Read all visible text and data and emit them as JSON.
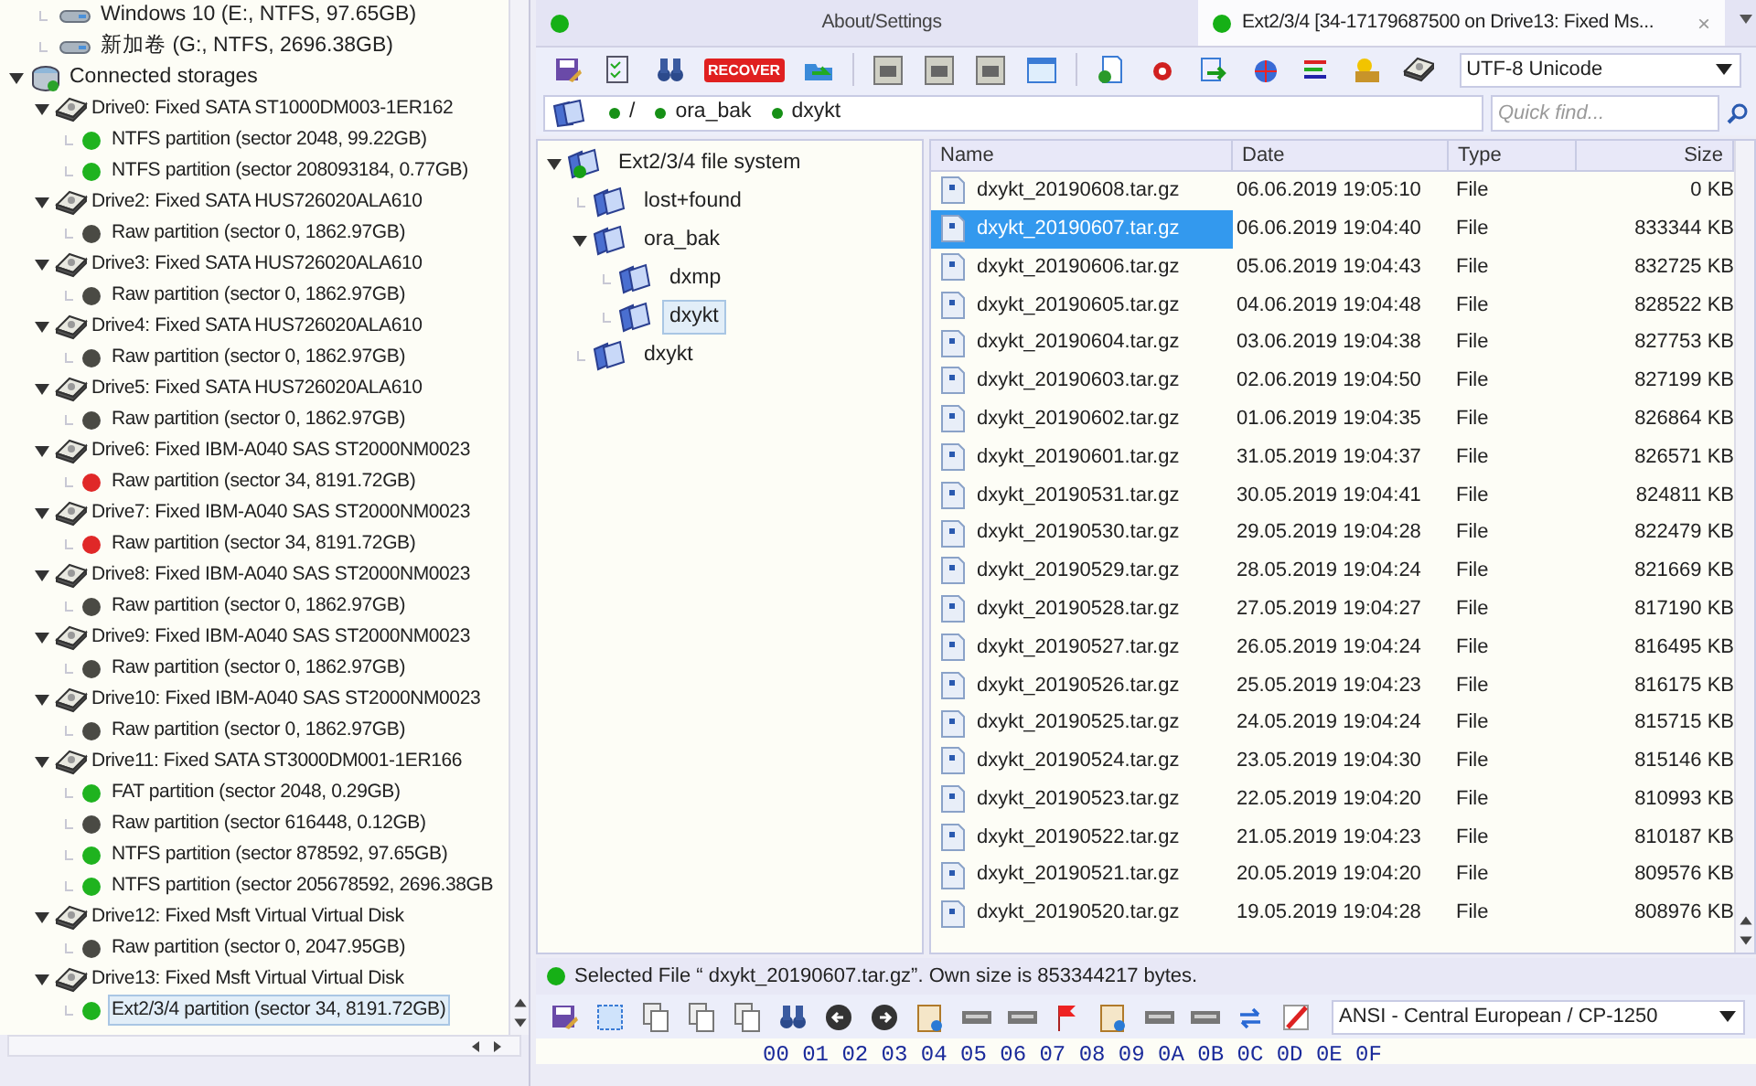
{
  "storage_tree": {
    "local_volumes": [
      {
        "label": "Windows 10 (E:, NTFS, 97.65GB)"
      },
      {
        "label": "新加卷 (G:, NTFS, 2696.38GB)"
      }
    ],
    "connected_storages": {
      "label": "Connected storages",
      "expanded": true,
      "drives": [
        {
          "label": "Drive0: Fixed SATA ST1000DM003-1ER162",
          "expanded": true,
          "partitions": [
            {
              "label": "NTFS partition (sector 2048, 99.22GB)",
              "color": "#1fb31f",
              "selected": false
            },
            {
              "label": "NTFS partition (sector 208093184, 0.77GB)",
              "color": "#1fb31f",
              "selected": false
            }
          ]
        },
        {
          "label": "Drive2: Fixed SATA HUS726020ALA610",
          "expanded": true,
          "partitions": [
            {
              "label": "Raw partition (sector 0, 1862.97GB)",
              "color": "#4a4a44",
              "selected": false
            }
          ]
        },
        {
          "label": "Drive3: Fixed SATA HUS726020ALA610",
          "expanded": true,
          "partitions": [
            {
              "label": "Raw partition (sector 0, 1862.97GB)",
              "color": "#4a4a44",
              "selected": false
            }
          ]
        },
        {
          "label": "Drive4: Fixed SATA HUS726020ALA610",
          "expanded": true,
          "partitions": [
            {
              "label": "Raw partition (sector 0, 1862.97GB)",
              "color": "#4a4a44",
              "selected": false
            }
          ]
        },
        {
          "label": "Drive5: Fixed SATA HUS726020ALA610",
          "expanded": true,
          "partitions": [
            {
              "label": "Raw partition (sector 0, 1862.97GB)",
              "color": "#4a4a44",
              "selected": false
            }
          ]
        },
        {
          "label": "Drive6: Fixed IBM-A040 SAS ST2000NM0023",
          "expanded": true,
          "partitions": [
            {
              "label": "Raw partition (sector 34, 8191.72GB)",
              "color": "#e02828",
              "selected": false
            }
          ]
        },
        {
          "label": "Drive7: Fixed IBM-A040 SAS ST2000NM0023",
          "expanded": true,
          "partitions": [
            {
              "label": "Raw partition (sector 34, 8191.72GB)",
              "color": "#e02828",
              "selected": false
            }
          ]
        },
        {
          "label": "Drive8: Fixed IBM-A040 SAS ST2000NM0023",
          "expanded": true,
          "partitions": [
            {
              "label": "Raw partition (sector 0, 1862.97GB)",
              "color": "#4a4a44",
              "selected": false
            }
          ]
        },
        {
          "label": "Drive9: Fixed IBM-A040 SAS ST2000NM0023",
          "expanded": true,
          "partitions": [
            {
              "label": "Raw partition (sector 0, 1862.97GB)",
              "color": "#4a4a44",
              "selected": false
            }
          ]
        },
        {
          "label": "Drive10: Fixed IBM-A040 SAS ST2000NM0023",
          "expanded": true,
          "partitions": [
            {
              "label": "Raw partition (sector 0, 1862.97GB)",
              "color": "#4a4a44",
              "selected": false
            }
          ]
        },
        {
          "label": "Drive11: Fixed SATA ST3000DM001-1ER166",
          "expanded": true,
          "partitions": [
            {
              "label": "FAT partition (sector 2048, 0.29GB)",
              "color": "#1fb31f",
              "selected": false
            },
            {
              "label": "Raw partition (sector 616448, 0.12GB)",
              "color": "#4a4a44",
              "selected": false
            },
            {
              "label": "NTFS partition (sector 878592, 97.65GB)",
              "color": "#1fb31f",
              "selected": false
            },
            {
              "label": "NTFS partition (sector 205678592, 2696.38GB",
              "color": "#1fb31f",
              "selected": false
            }
          ]
        },
        {
          "label": "Drive12: Fixed Msft Virtual Virtual Disk",
          "expanded": true,
          "partitions": [
            {
              "label": "Raw partition (sector 0, 2047.95GB)",
              "color": "#4a4a44",
              "selected": false
            }
          ]
        },
        {
          "label": "Drive13: Fixed Msft Virtual Virtual Disk",
          "expanded": true,
          "partitions": [
            {
              "label": "Ext2/3/4 partition (sector 34, 8191.72GB)",
              "color": "#1fb31f",
              "selected": true
            }
          ]
        }
      ]
    }
  },
  "tabs": [
    {
      "label": "About/Settings",
      "selected": false
    },
    {
      "label": "Ext2/3/4 [34-17179687500 on Drive13: Fixed Ms...",
      "selected": true,
      "close": "×"
    }
  ],
  "toolbar": {
    "recover_button": "RECOVER",
    "encoding": "UTF-8 Unicode"
  },
  "path_bar": {
    "segments": [
      "/",
      "ora_bak",
      "dxykt"
    ],
    "quick_find_placeholder": "Quick find..."
  },
  "folder_tree": {
    "label": "Ext2/3/4 file system",
    "expanded": true,
    "children": [
      {
        "label": "lost+found",
        "expanded": false,
        "selected": false
      },
      {
        "label": "ora_bak",
        "expanded": true,
        "selected": false,
        "children": [
          {
            "label": "dxmp",
            "expanded": false,
            "selected": false
          },
          {
            "label": "dxykt",
            "expanded": false,
            "selected": true
          }
        ]
      },
      {
        "label": "dxykt",
        "expanded": false,
        "selected": false
      }
    ]
  },
  "file_table": {
    "columns": [
      "Name",
      "Date",
      "Type",
      "Size"
    ],
    "rows": [
      {
        "name": "dxykt_20190608.tar.gz",
        "date": "06.06.2019 19:05:10",
        "type": "File",
        "size": "0 KB",
        "selected": false
      },
      {
        "name": "dxykt_20190607.tar.gz",
        "date": "06.06.2019 19:04:40",
        "type": "File",
        "size": "833344 KB",
        "selected": true
      },
      {
        "name": "dxykt_20190606.tar.gz",
        "date": "05.06.2019 19:04:43",
        "type": "File",
        "size": "832725 KB",
        "selected": false
      },
      {
        "name": "dxykt_20190605.tar.gz",
        "date": "04.06.2019 19:04:48",
        "type": "File",
        "size": "828522 KB",
        "selected": false
      },
      {
        "name": "dxykt_20190604.tar.gz",
        "date": "03.06.2019 19:04:38",
        "type": "File",
        "size": "827753 KB",
        "selected": false
      },
      {
        "name": "dxykt_20190603.tar.gz",
        "date": "02.06.2019 19:04:50",
        "type": "File",
        "size": "827199 KB",
        "selected": false
      },
      {
        "name": "dxykt_20190602.tar.gz",
        "date": "01.06.2019 19:04:35",
        "type": "File",
        "size": "826864 KB",
        "selected": false
      },
      {
        "name": "dxykt_20190601.tar.gz",
        "date": "31.05.2019 19:04:37",
        "type": "File",
        "size": "826571 KB",
        "selected": false
      },
      {
        "name": "dxykt_20190531.tar.gz",
        "date": "30.05.2019 19:04:41",
        "type": "File",
        "size": "824811 KB",
        "selected": false
      },
      {
        "name": "dxykt_20190530.tar.gz",
        "date": "29.05.2019 19:04:28",
        "type": "File",
        "size": "822479 KB",
        "selected": false
      },
      {
        "name": "dxykt_20190529.tar.gz",
        "date": "28.05.2019 19:04:24",
        "type": "File",
        "size": "821669 KB",
        "selected": false
      },
      {
        "name": "dxykt_20190528.tar.gz",
        "date": "27.05.2019 19:04:27",
        "type": "File",
        "size": "817190 KB",
        "selected": false
      },
      {
        "name": "dxykt_20190527.tar.gz",
        "date": "26.05.2019 19:04:24",
        "type": "File",
        "size": "816495 KB",
        "selected": false
      },
      {
        "name": "dxykt_20190526.tar.gz",
        "date": "25.05.2019 19:04:23",
        "type": "File",
        "size": "816175 KB",
        "selected": false
      },
      {
        "name": "dxykt_20190525.tar.gz",
        "date": "24.05.2019 19:04:24",
        "type": "File",
        "size": "815715 KB",
        "selected": false
      },
      {
        "name": "dxykt_20190524.tar.gz",
        "date": "23.05.2019 19:04:30",
        "type": "File",
        "size": "815146 KB",
        "selected": false
      },
      {
        "name": "dxykt_20190523.tar.gz",
        "date": "22.05.2019 19:04:20",
        "type": "File",
        "size": "810993 KB",
        "selected": false
      },
      {
        "name": "dxykt_20190522.tar.gz",
        "date": "21.05.2019 19:04:23",
        "type": "File",
        "size": "810187 KB",
        "selected": false
      },
      {
        "name": "dxykt_20190521.tar.gz",
        "date": "20.05.2019 19:04:20",
        "type": "File",
        "size": "809576 KB",
        "selected": false
      },
      {
        "name": "dxykt_20190520.tar.gz",
        "date": "19.05.2019 19:04:28",
        "type": "File",
        "size": "808976 KB",
        "selected": false
      }
    ]
  },
  "status_bar": {
    "text": "Selected File “ dxykt_20190607.tar.gz”. Own size is 853344217 bytes."
  },
  "hex_toolbar": {
    "encoding": "ANSI - Central European / CP-1250"
  },
  "hex_view": {
    "header": "00 01 02 03 04 05 06 07 08 09 0A 0B 0C 0D 0E 0F"
  }
}
